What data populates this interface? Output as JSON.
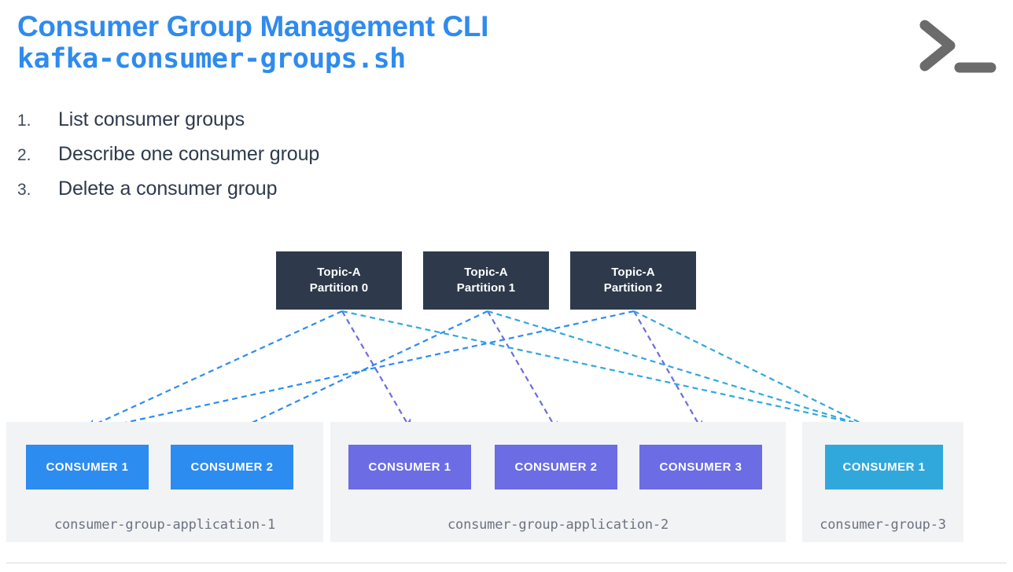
{
  "header": {
    "title": "Consumer Group Management CLI",
    "subtitle": "kafka-consumer-groups.sh",
    "title_color": "#2E8BEF",
    "icon": "terminal-prompt-icon",
    "icon_color": "#6B6B6B"
  },
  "list": {
    "items": [
      {
        "num": "1.",
        "text": "List consumer groups"
      },
      {
        "num": "2.",
        "text": "Describe one consumer group"
      },
      {
        "num": "3.",
        "text": "Delete a consumer group"
      }
    ]
  },
  "diagram": {
    "partitions": [
      {
        "topic": "Topic-A",
        "partition": "Partition 0"
      },
      {
        "topic": "Topic-A",
        "partition": "Partition 1"
      },
      {
        "topic": "Topic-A",
        "partition": "Partition 2"
      }
    ],
    "partition_color": "#2E3A4B",
    "groups": [
      {
        "name": "consumer-group-application-1",
        "color": "#2D8CF0",
        "consumers": [
          "CONSUMER 1",
          "CONSUMER 2"
        ]
      },
      {
        "name": "consumer-group-application-2",
        "color": "#6C6CE5",
        "consumers": [
          "CONSUMER 1",
          "CONSUMER 2",
          "CONSUMER 3"
        ]
      },
      {
        "name": "consumer-group-3",
        "color": "#31A8DC",
        "consumers": [
          "CONSUMER 1"
        ]
      }
    ],
    "panel_color": "#F2F3F5",
    "arrow_colors": {
      "group1": "#2D8CF0",
      "group2": "#6C6CE5",
      "group3": "#31A8DC"
    }
  }
}
